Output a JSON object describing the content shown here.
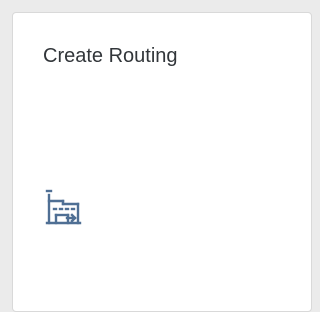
{
  "tile": {
    "title": "Create Routing",
    "icon": "factory-icon",
    "icon_color": "#4f6f94",
    "background": "#ffffff",
    "page_background": "#ebebeb"
  }
}
